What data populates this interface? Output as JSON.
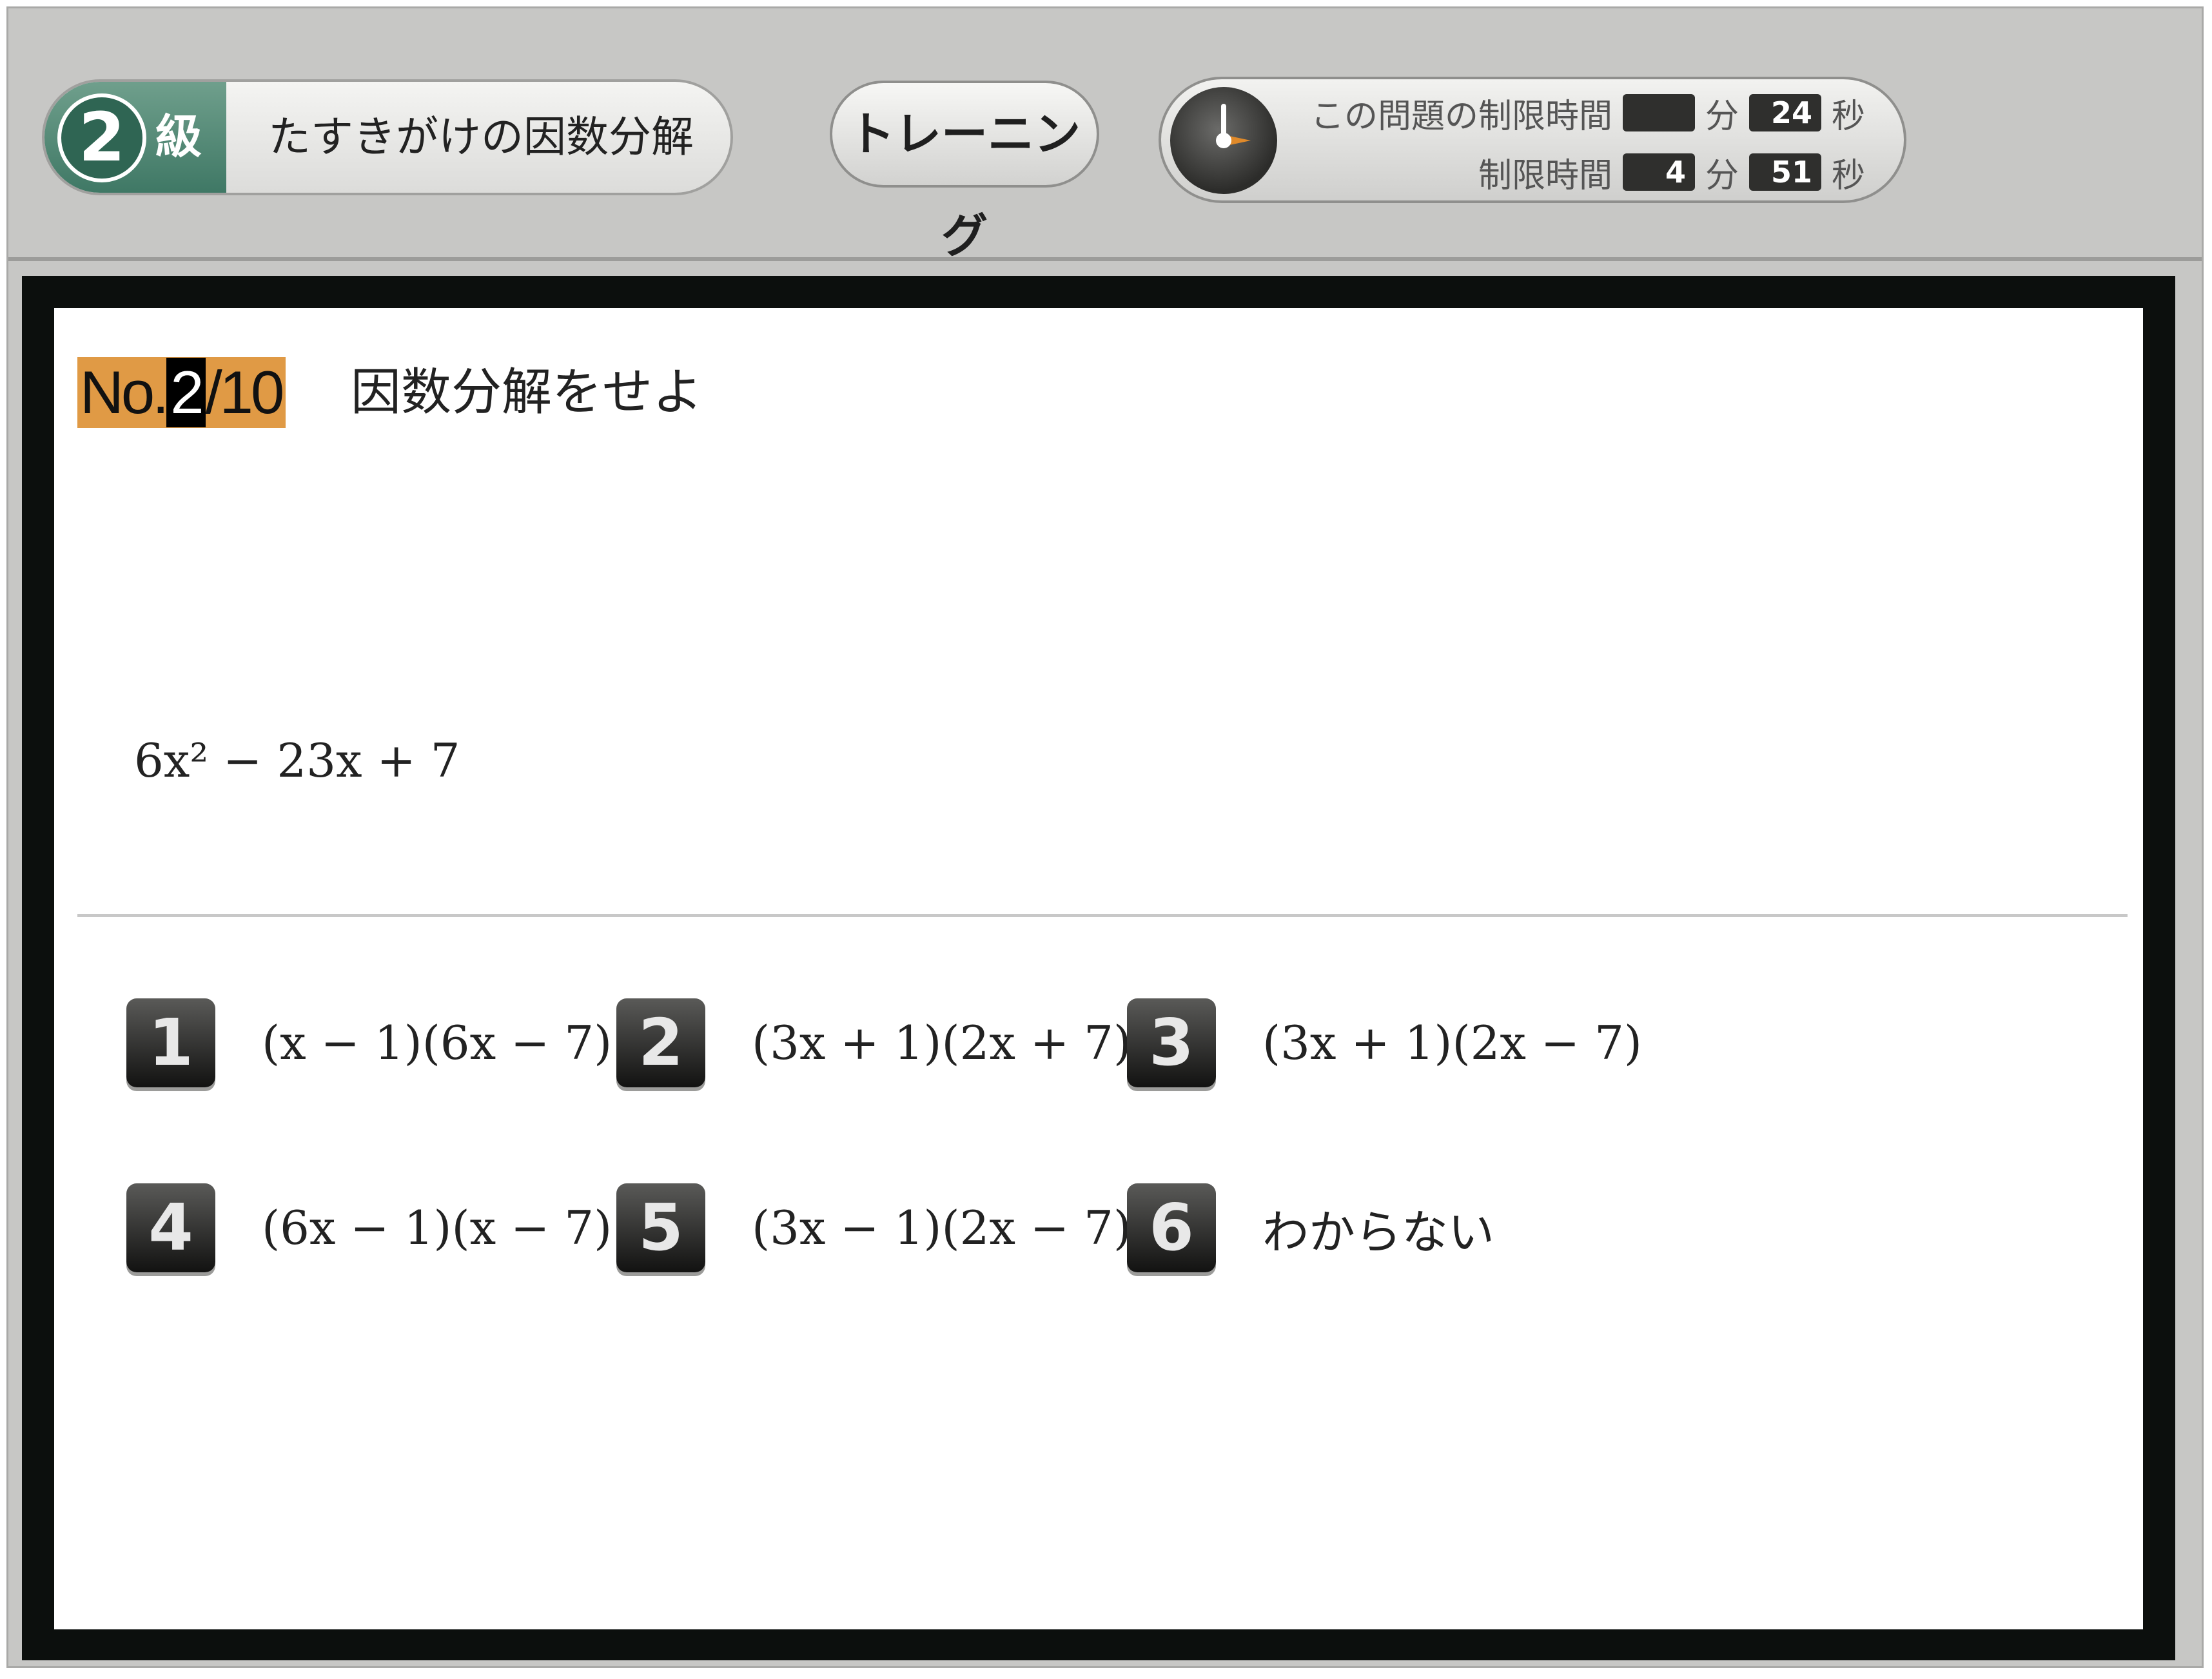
{
  "header": {
    "grade_number": "2",
    "grade_label": "級",
    "topic": "たすきがけの因数分解",
    "mode_button": "トレーニング",
    "timer": {
      "problem_limit_label": "この問題の制限時間",
      "problem_minutes": "",
      "minute_unit": "分",
      "problem_seconds": "24",
      "second_unit": "秒",
      "total_limit_label": "制限時間",
      "total_minutes": "4",
      "total_seconds": "51"
    }
  },
  "question": {
    "prefix": "No.",
    "current": "2",
    "total": "/10",
    "instruction": "因数分解をせよ",
    "expression": "6x² − 23x + 7"
  },
  "choices": [
    {
      "num": "1",
      "text": "(x − 1)(6x − 7)"
    },
    {
      "num": "2",
      "text": "(3x + 1)(2x + 7)"
    },
    {
      "num": "3",
      "text": "(3x + 1)(2x − 7)"
    },
    {
      "num": "4",
      "text": "(6x − 1)(x − 7)"
    },
    {
      "num": "5",
      "text": "(3x − 1)(2x − 7)"
    },
    {
      "num": "6",
      "text": "わからない"
    }
  ],
  "colors": {
    "question_badge": "#e09a45",
    "grade_green": "#3f7865",
    "frame_gray": "#c7c7c5"
  }
}
